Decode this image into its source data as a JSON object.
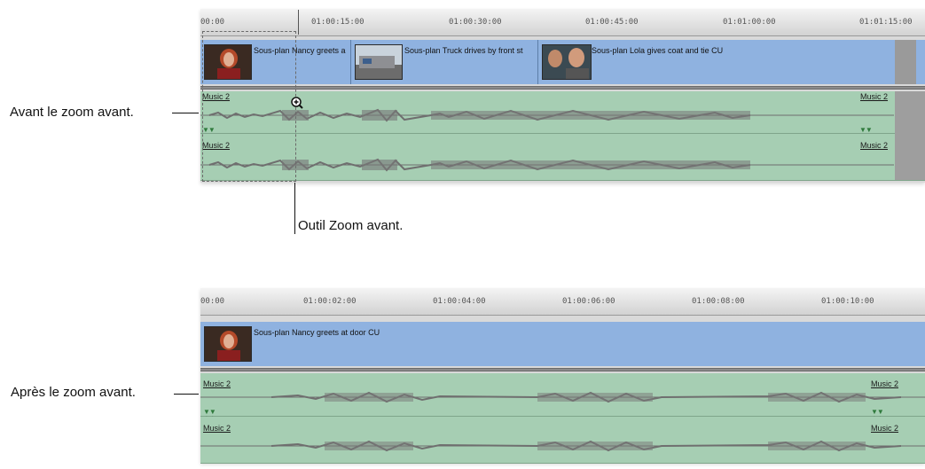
{
  "callouts": {
    "before": "Avant le zoom avant.",
    "tool": "Outil Zoom avant.",
    "after": "Après le zoom avant."
  },
  "timeline_top": {
    "timecodes": [
      "00:00",
      "01:00:15:00",
      "01:00:30:00",
      "01:00:45:00",
      "01:01:00:00",
      "01:01:15:00"
    ],
    "clips": [
      "Sous-plan Nancy greets a",
      "Sous-plan Truck drives by front st",
      "Sous-plan Lola gives coat and tie CU"
    ],
    "audio": {
      "a1_left": "Music 2",
      "a1_right": "Music 2",
      "a2_left": "Music 2",
      "a2_right": "Music 2"
    }
  },
  "timeline_bottom": {
    "timecodes": [
      "00:00",
      "01:00:02:00",
      "01:00:04:00",
      "01:00:06:00",
      "01:00:08:00",
      "01:00:10:00"
    ],
    "clips": [
      "Sous-plan Nancy greets at door CU"
    ],
    "audio": {
      "a1_left": "Music 2",
      "a1_right": "Music 2",
      "a2_left": "Music 2",
      "a2_right": "Music 2"
    }
  },
  "colors": {
    "video_track": "#8fb2e0",
    "audio_track": "#a6ceb3",
    "waveform": "#6f6f6f"
  },
  "icons": [
    "zoom-in-tool-icon",
    "keyframe-marker-icon"
  ]
}
